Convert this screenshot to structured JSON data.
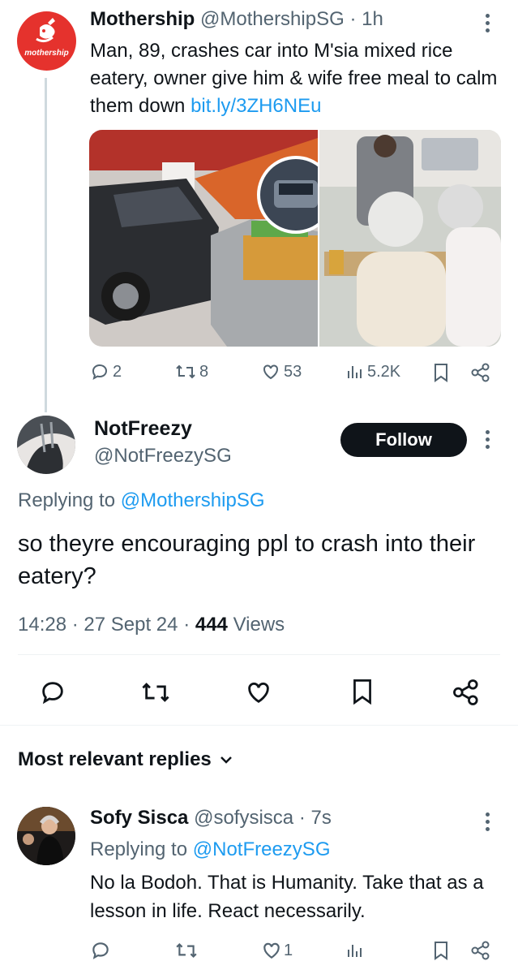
{
  "parent_tweet": {
    "display_name": "Mothership",
    "handle": "@MothershipSG",
    "time": "1h",
    "avatar_word": "mothership",
    "text": "Man, 89, crashes car into M'sia mixed rice eatery, owner give him & wife free meal to calm them down ",
    "link_text": "bit.ly/3ZH6NEu",
    "stats": {
      "replies": "2",
      "reposts": "8",
      "likes": "53",
      "views": "5.2K"
    }
  },
  "reply_tweet": {
    "display_name": "NotFreezy",
    "handle": "@NotFreezySG",
    "follow_label": "Follow",
    "replying_prefix": "Replying to ",
    "replying_handle": "@MothershipSG",
    "text": "so theyre encouraging ppl to crash into their eatery?",
    "time": "14:28",
    "date": "27 Sept 24",
    "views_count": "444",
    "views_label": "Views"
  },
  "replies_section": {
    "title": "Most relevant replies"
  },
  "third_reply": {
    "display_name": "Sofy Sisca",
    "handle": "@sofysisca",
    "time": "7s",
    "replying_prefix": "Replying to ",
    "replying_handle": "@NotFreezySG",
    "text": "No la Bodoh. That is Humanity. Take that as a lesson in life. React necessarily.",
    "stats": {
      "likes": "1"
    }
  },
  "colors": {
    "brand_red": "#e5322d",
    "link_blue": "#1d9bf0",
    "text_primary": "#0f1419",
    "text_secondary": "#536471"
  },
  "icons": [
    "reply-icon",
    "repost-icon",
    "like-icon",
    "views-icon",
    "bookmark-icon",
    "share-icon",
    "more-icon",
    "chevron-down-icon"
  ]
}
